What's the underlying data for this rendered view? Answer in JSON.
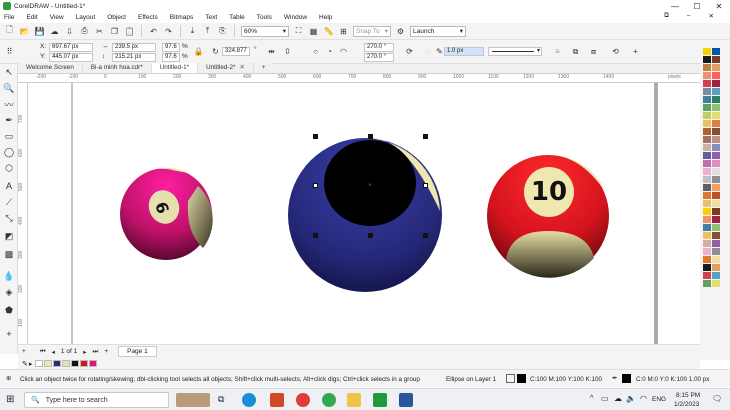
{
  "window": {
    "title": "CorelDRAW - Untitled-1*",
    "min": "—",
    "max": "☐",
    "close": "✕"
  },
  "menu": {
    "items": [
      "File",
      "Edit",
      "View",
      "Layout",
      "Object",
      "Effects",
      "Bitmaps",
      "Text",
      "Table",
      "Tools",
      "Window",
      "Help"
    ]
  },
  "toolbar": {
    "zoom": "60%",
    "launch": "Launch",
    "snap": "Snap To"
  },
  "props": {
    "x_label": "X:",
    "x_value": "697.67 px",
    "y_label": "Y:",
    "y_value": "445.07 px",
    "w_value": "239.5 px",
    "h_value": "215.21 px",
    "sx": "97.6",
    "sy": "97.6",
    "pct": "%",
    "angle": "324.877",
    "deg": "°",
    "arc1": "270.0 °",
    "arc2": "270.0 °",
    "outline": "1.0 px"
  },
  "tabs": [
    {
      "label": "Welcome Screen"
    },
    {
      "label": "Bi-a minh hoa.cdr*"
    },
    {
      "label": "Untitled-1*"
    },
    {
      "label": "Untitled-2*"
    }
  ],
  "ruler": {
    "h": [
      "-200",
      "-100",
      "0",
      "100",
      "200",
      "300",
      "400",
      "500",
      "600",
      "700",
      "800",
      "900",
      "1000",
      "1100",
      "1200",
      "1300",
      "1400",
      "pixels"
    ],
    "v": [
      "700",
      "600",
      "500",
      "400",
      "300",
      "200",
      "100",
      "0"
    ]
  },
  "balls": {
    "left_number": "9",
    "right_number": "10"
  },
  "pagebar": {
    "pages": "1 of 1",
    "page_tab": "Page 1"
  },
  "status": {
    "hint": "Click an object twice for rotating/skewing; dbl-clicking tool selects all objects; Shift+click multi-selects; Alt+click digs; Ctrl+click selects in a group",
    "layer": "Ellipse on Layer 1",
    "fill": "C:100 M:100 Y:100 K:100",
    "outline": "C:0 M:0 Y:0 K:100  1.00 px"
  },
  "taskbar": {
    "search": "Type here to search",
    "lang": "ENG",
    "time": "8:15 PM",
    "date": "1/2/2023"
  },
  "colors": {
    "accent_ball_left": "#e0157a",
    "accent_ball_mid": "#252878",
    "accent_ball_right": "#d4131e",
    "cream": "#efe7b0"
  }
}
